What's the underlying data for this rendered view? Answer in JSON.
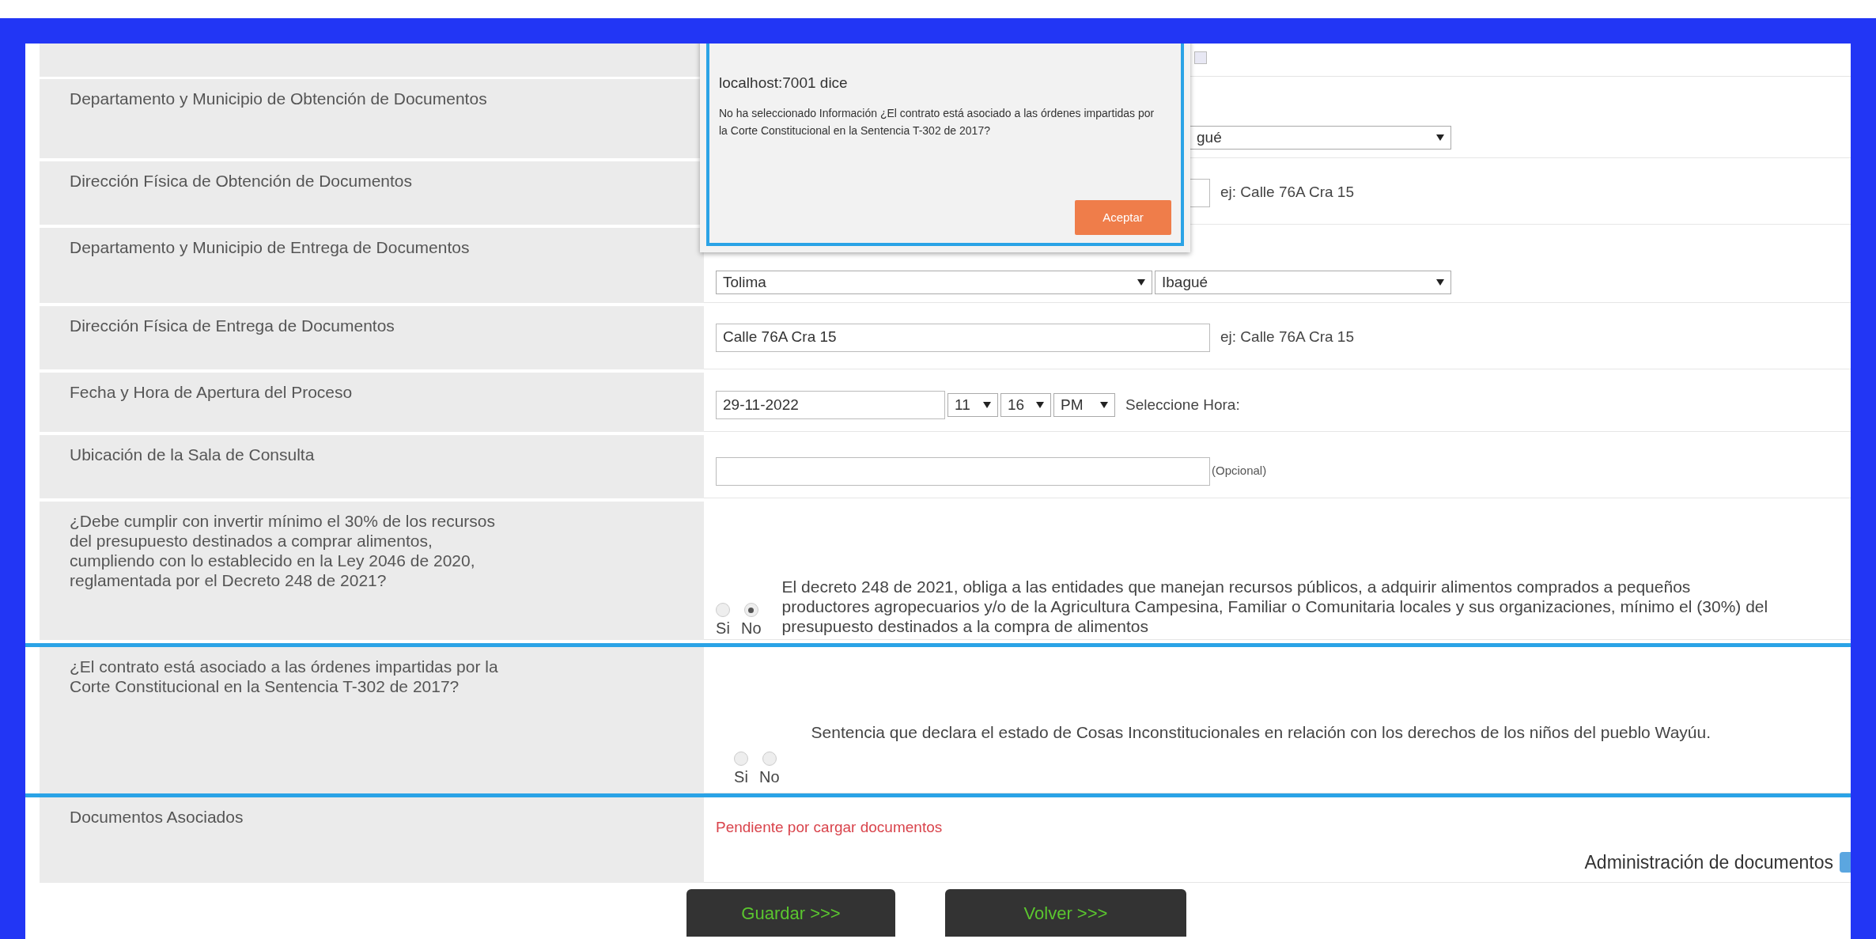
{
  "dialog": {
    "title": "localhost:7001 dice",
    "message": "No ha seleccionado Información ¿El contrato está asociado a las órdenes impartidas por la Corte Constitucional en la Sentencia T-302 de 2017?",
    "button": "Aceptar"
  },
  "top_checkbox": {
    "checked": false
  },
  "rows": [
    {
      "kind": "selects",
      "label": "Departamento y Municipio de Obtención de Documentos",
      "highlighted": false,
      "selects": [
        {
          "value": "gué"
        }
      ]
    },
    {
      "kind": "address",
      "label": "Dirección Física de Obtención de Documentos",
      "highlighted": false,
      "hint": "ej: Calle 76A Cra 15"
    },
    {
      "kind": "selects",
      "label": "Departamento y Municipio de Entrega de Documentos",
      "highlighted": false,
      "selects": [
        {
          "value": "Tolima"
        },
        {
          "value": "Ibagué"
        }
      ]
    },
    {
      "kind": "address",
      "label": "Dirección Física de Entrega de Documentos",
      "highlighted": false,
      "value": "Calle 76A Cra 15",
      "hint": "ej: Calle 76A Cra 15"
    },
    {
      "kind": "datetime",
      "label": "Fecha y Hora de Apertura del Proceso",
      "highlighted": false,
      "date": "29-11-2022",
      "hour": "11",
      "minute": "16",
      "ampm": "PM",
      "note": "Seleccione Hora:"
    },
    {
      "kind": "optional",
      "label": "Ubicación de la Sala de Consulta",
      "highlighted": false,
      "note": "(Opcional)"
    },
    {
      "kind": "radio",
      "label": "¿Debe cumplir con invertir mínimo el 30% de los recursos del presupuesto destinados a comprar alimentos, cumpliendo con lo establecido en la Ley 2046 de 2020, reglamentada por el Decreto 248 de 2021?",
      "highlighted": false,
      "options": [
        {
          "label": "Si",
          "selected": false
        },
        {
          "label": "No",
          "selected": true
        }
      ],
      "description": "El decreto 248 de 2021, obliga a las entidades que manejan recursos públicos, a adquirir alimentos comprados a pequeños productores agropecuarios y/o de la Agricultura Campesina, Familiar o Comunitaria locales y sus organizaciones, mínimo el (30%) del presupuesto destinados a la compra de alimentos"
    },
    {
      "kind": "radio",
      "label": "¿El contrato está asociado a las órdenes impartidas por la Corte Constitucional en la Sentencia T-302 de 2017?",
      "highlighted": true,
      "options": [
        {
          "label": "Si",
          "selected": false
        },
        {
          "label": "No",
          "selected": false
        }
      ],
      "description": "Sentencia que declara el estado de Cosas Inconstitucionales en relación con los derechos de los niños del pueblo Wayúu."
    },
    {
      "kind": "documents",
      "label": "Documentos Asociados",
      "highlighted": false,
      "status": "Pendiente por cargar documentos",
      "link": "Administración de documentos"
    }
  ],
  "buttons": [
    "Guardar >>>",
    "Volver >>>"
  ]
}
